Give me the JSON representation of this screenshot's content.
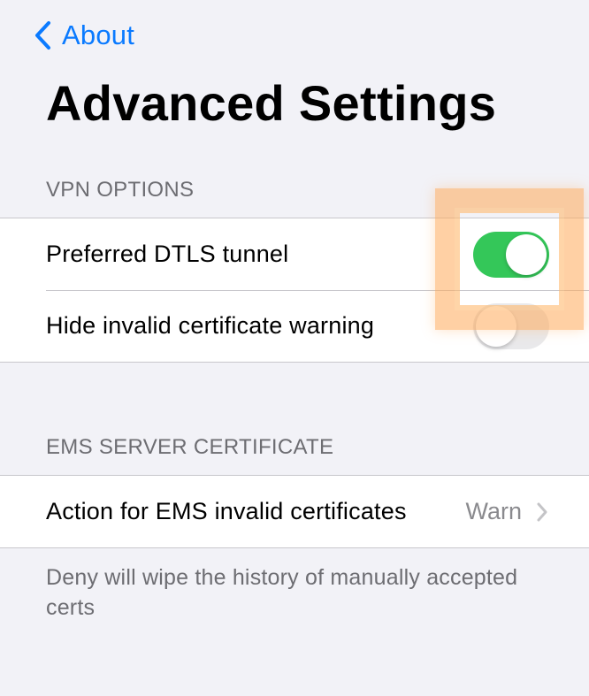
{
  "nav": {
    "back_label": "About",
    "title": "Advanced Settings"
  },
  "vpn_options": {
    "header": "VPN OPTIONS",
    "rows": [
      {
        "label": "Preferred DTLS tunnel",
        "toggle": "on"
      },
      {
        "label": "Hide invalid certificate warning",
        "toggle": "off"
      }
    ]
  },
  "ems_certificate": {
    "header": "EMS SERVER CERTIFICATE",
    "rows": [
      {
        "label": "Action for EMS invalid certificates",
        "value": "Warn"
      }
    ],
    "footer": "Deny will wipe the history of manually accepted certs"
  },
  "colors": {
    "accent": "#0a7aff",
    "toggle_on": "#34c759",
    "toggle_off": "#e9e9eb",
    "highlight": "#ffaa5a",
    "background": "#f2f2f7"
  },
  "icons": {
    "back": "chevron-left-icon",
    "disclosure": "chevron-right-icon"
  }
}
